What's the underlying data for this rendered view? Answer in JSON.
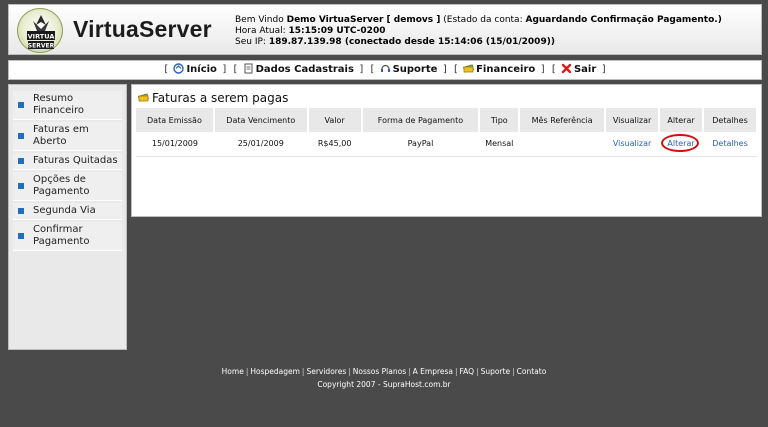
{
  "header": {
    "logo_text": "VirtuaServer",
    "badge_text_top": "VIRTUA",
    "badge_text_bottom": "SERVER",
    "welcome_prefix": "Bem Vindo",
    "user_name": "Demo VirtuaServer [ demovs ]",
    "account_status_prefix": "(Estado da conta:",
    "account_status": "Aguardando Confirmação Pagamento.)",
    "time_label": "Hora Atual:",
    "time_value": "15:15:09 UTC-0200",
    "ip_label": "Seu IP:",
    "ip_value": "189.87.139.98 (conectado desde 15:14:06 (15/01/2009))"
  },
  "nav": {
    "items": [
      {
        "label": "Início",
        "icon": "home-icon"
      },
      {
        "label": "Dados Cadastrais",
        "icon": "document-icon"
      },
      {
        "label": "Suporte",
        "icon": "support-icon"
      },
      {
        "label": "Financeiro",
        "icon": "money-icon"
      },
      {
        "label": "Sair",
        "icon": "exit-icon"
      }
    ],
    "open_bracket": "[",
    "close_bracket": "]"
  },
  "sidebar": {
    "items": [
      {
        "label": "Resumo Financeiro"
      },
      {
        "label": "Faturas em Aberto"
      },
      {
        "label": "Faturas Quitadas"
      },
      {
        "label": "Opções de Pagamento"
      },
      {
        "label": "Segunda Via"
      },
      {
        "label": "Confirmar Pagamento"
      }
    ]
  },
  "main": {
    "title": "Faturas a serem pagas",
    "columns": [
      "Data Emissão",
      "Data Vencimento",
      "Valor",
      "Forma de Pagamento",
      "Tipo",
      "Mês Referência",
      "Visualizar",
      "Alterar",
      "Detalhes"
    ],
    "rows": [
      {
        "data_emissao": "15/01/2009",
        "data_vencimento": "25/01/2009",
        "valor": "R$45,00",
        "forma_pagamento": "PayPal",
        "tipo": "Mensal",
        "mes_referencia": "",
        "visualizar": "Visualizar",
        "alterar": "Alterar",
        "detalhes": "Detalhes"
      }
    ]
  },
  "footer": {
    "links": [
      "Home",
      "Hospedagem",
      "Servidores",
      "Nossos Planos",
      "A Empresa",
      "FAQ",
      "Suporte",
      "Contato"
    ],
    "separator": "|",
    "copyright": "Copyright 2007 - SupraHost.com.br"
  },
  "colors": {
    "background": "#4a4a4a",
    "link": "#2a62b5",
    "highlight_ring": "#cc1212",
    "bullet": "#1f6fbf"
  }
}
